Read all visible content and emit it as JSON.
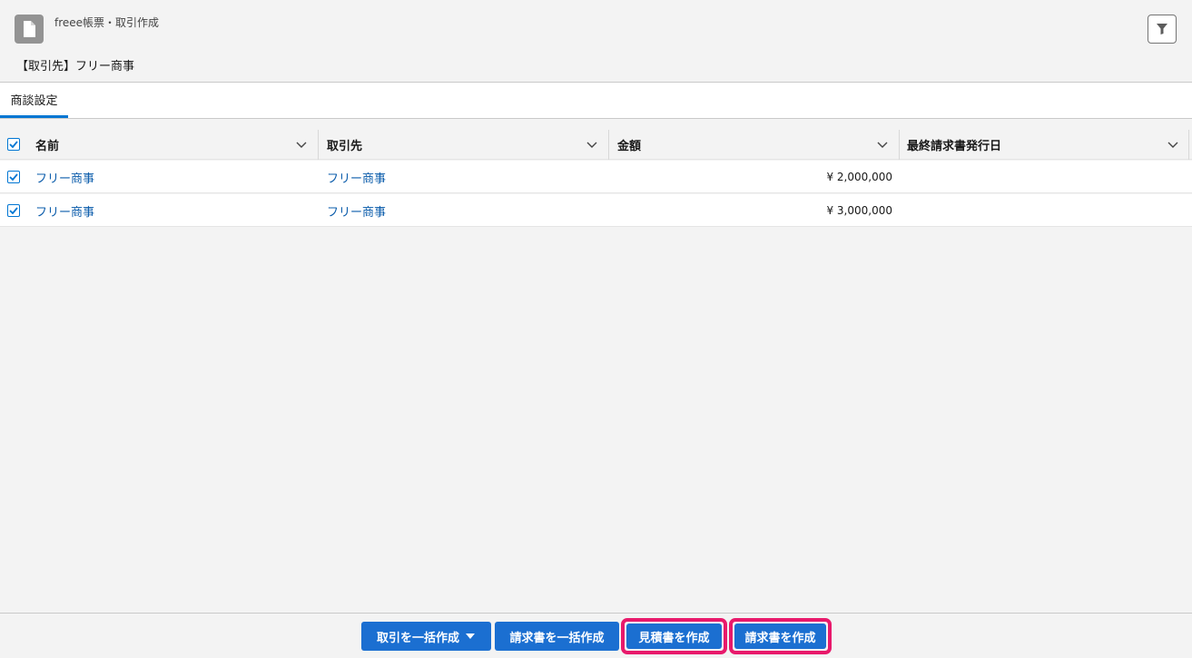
{
  "header": {
    "app_title": "freee帳票・取引作成",
    "record_name": "【取引先】フリー商事",
    "icons": {
      "app": "document-icon",
      "filter": "filter-icon"
    }
  },
  "tabs": [
    {
      "label": "商談設定",
      "active": true
    }
  ],
  "table": {
    "columns": [
      "名前",
      "取引先",
      "金額",
      "最終請求書発行日"
    ],
    "select_all_checked": true,
    "rows": [
      {
        "checked": true,
        "name": "フリー商事",
        "account": "フリー商事",
        "amount": "¥ 2,000,000",
        "last_invoice_date": ""
      },
      {
        "checked": true,
        "name": "フリー商事",
        "account": "フリー商事",
        "amount": "¥ 3,000,000",
        "last_invoice_date": ""
      }
    ]
  },
  "footer": {
    "buttons": {
      "bulk_deal": "取引を一括作成",
      "bulk_invoice": "請求書を一括作成",
      "create_quote": "見積書を作成",
      "create_invoice": "請求書を作成"
    },
    "highlight_color": "#e8196b",
    "button_color": "#1b6fd1"
  }
}
